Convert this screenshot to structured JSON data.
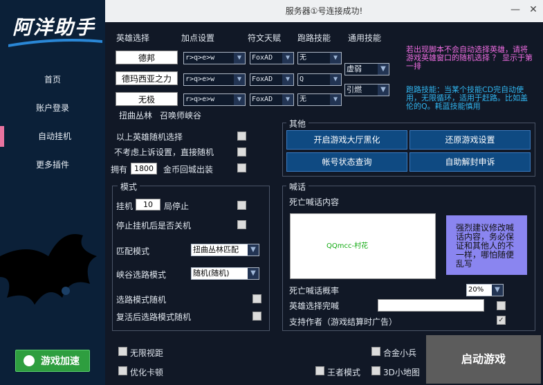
{
  "sidebar": {
    "logo": "阿洋助手",
    "items": [
      {
        "label": "首页"
      },
      {
        "label": "账户登录"
      },
      {
        "label": "自动挂机"
      },
      {
        "label": "更多插件"
      }
    ],
    "accel": "游戏加速"
  },
  "window": {
    "title": "服务器①号连接成功!",
    "min": "—",
    "close": "✕"
  },
  "headers": {
    "hero": "英雄选择",
    "points": "加点设置",
    "rune": "符文天赋",
    "route": "跑路技能",
    "common": "通用技能"
  },
  "heroes": [
    {
      "name": "德邦",
      "points": "r>q>e>w",
      "rune": "FoxAD",
      "route": "无"
    },
    {
      "name": "德玛西亚之力",
      "points": "r>q>e>w",
      "rune": "FoxAD",
      "route": "Q"
    },
    {
      "name": "无极",
      "points": "r>q>e>w",
      "rune": "FoxAD",
      "route": "无"
    }
  ],
  "common_skills": [
    "虚弱",
    "引燃"
  ],
  "maps": {
    "twisted": "扭曲丛林",
    "summoner": "召唤师峡谷"
  },
  "tips": {
    "pink": "若出现脚本不会自动选择英雄，请将游戏英雄窗口的随机选择 ？ 显示于第一排",
    "cyan": "跑路技能：当某个技能CD完自动使用，无限循环，适用于赶路。比如盖伦的Q。耗蓝技能慎用"
  },
  "options": {
    "random_above": "以上英雄随机选择",
    "ignore_points": "不考虑上诉设置，直接随机",
    "own_prefix": "拥有",
    "gold": "1800",
    "gold_suffix": "金币回城出装"
  },
  "other": {
    "title": "其他",
    "buttons": [
      "开启游戏大厅黑化",
      "还原游戏设置",
      "帐号状态查询",
      "自助解封申诉"
    ]
  },
  "mode": {
    "title": "模式",
    "afk_prefix": "挂机",
    "afk_count": "10",
    "afk_suffix": "局停止",
    "shutdown": "停止挂机后是否关机",
    "match_label": "匹配模式",
    "match_value": "扭曲丛林匹配",
    "valley_label": "峡谷选路模式",
    "valley_value": "随机(随机)",
    "route_random": "选路模式随机",
    "revive_random": "复活后选路模式随机"
  },
  "shout": {
    "title": "喊话",
    "death_content_label": "死亡喊话内容",
    "death_text": "QQmcc-村花",
    "notice": "强烈建议修改喊话内容，务必保证和其他人的不一样，哪怕随便乱写",
    "prob_label": "死亡喊话概率",
    "prob_value": "20%",
    "hero_shout": "英雄选择完喊",
    "support": "支持作者（游戏结算时广告）"
  },
  "bottom": {
    "unlimited": "无限视距",
    "optimize": "优化卡顿",
    "gold_minion": "合金小兵",
    "king": "王者模式",
    "map3d": "3D小地图",
    "start": "启动游戏"
  }
}
